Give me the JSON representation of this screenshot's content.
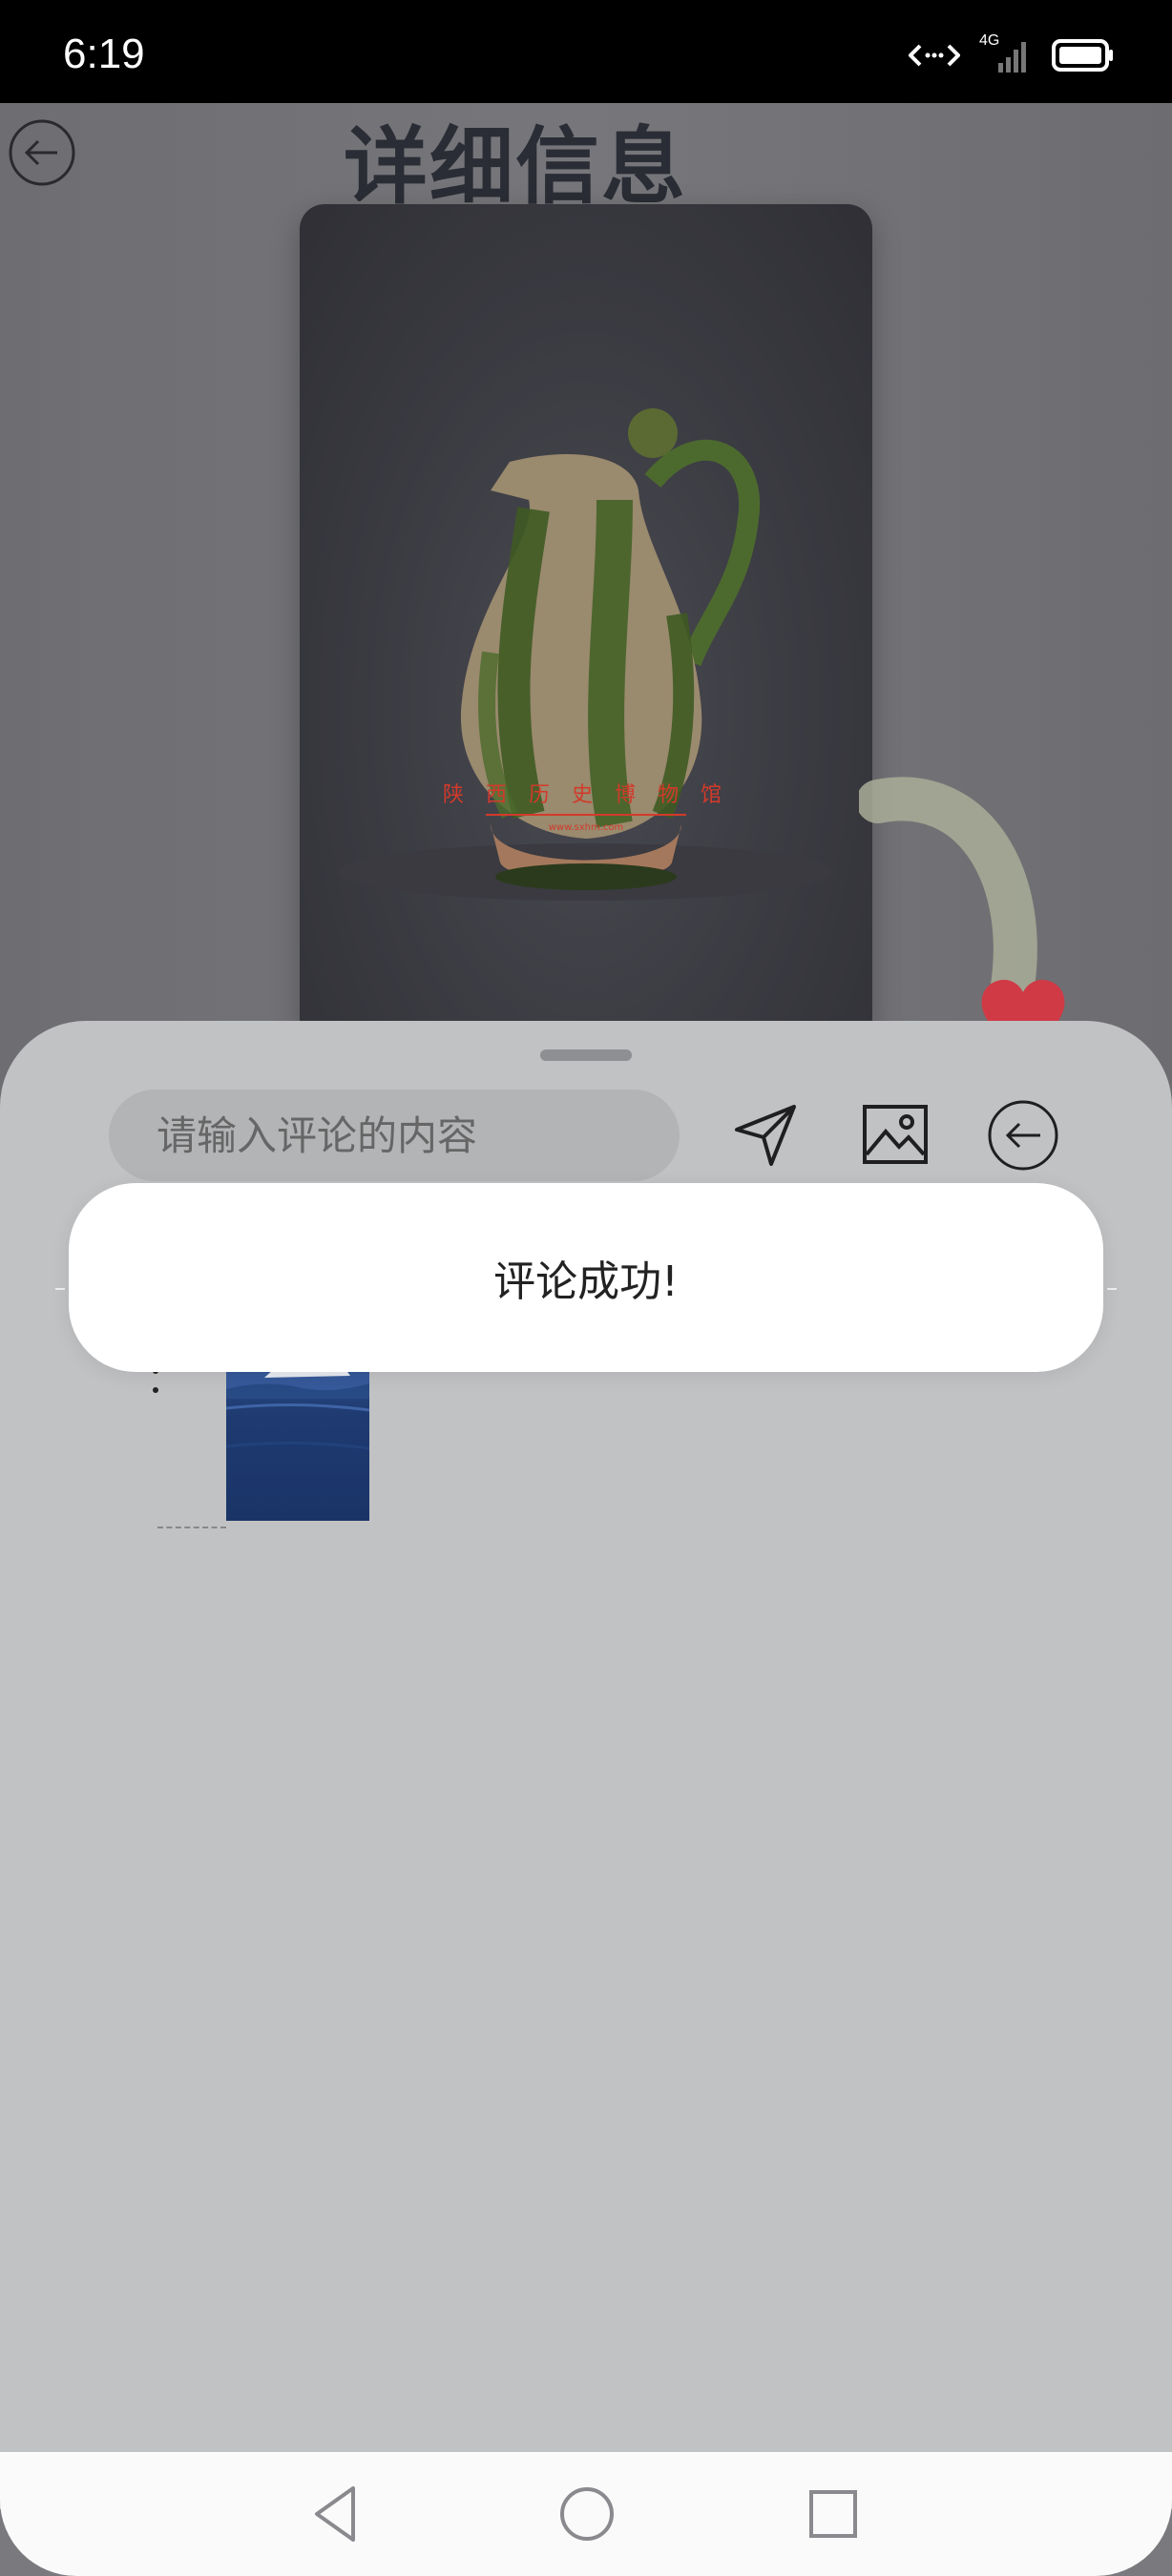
{
  "status_bar": {
    "time": "6:19",
    "network": "4G"
  },
  "header": {
    "title": "详细信息"
  },
  "comment_sheet": {
    "input_placeholder": "请输入评论的内容"
  },
  "toast": {
    "message": "评论成功!"
  },
  "icons": {
    "back": "back-arrow-circle-icon",
    "send": "send-paper-plane-icon",
    "image": "image-picture-icon",
    "close": "back-arrow-circle-icon",
    "like": "heart-icon",
    "nav_back": "triangle-back-icon",
    "nav_home": "circle-home-icon",
    "nav_recent": "square-recent-icon"
  },
  "colors": {
    "heart": "#d03a45",
    "toast_bg": "#ffffff",
    "sheet_bg": "#c1c2c4"
  }
}
